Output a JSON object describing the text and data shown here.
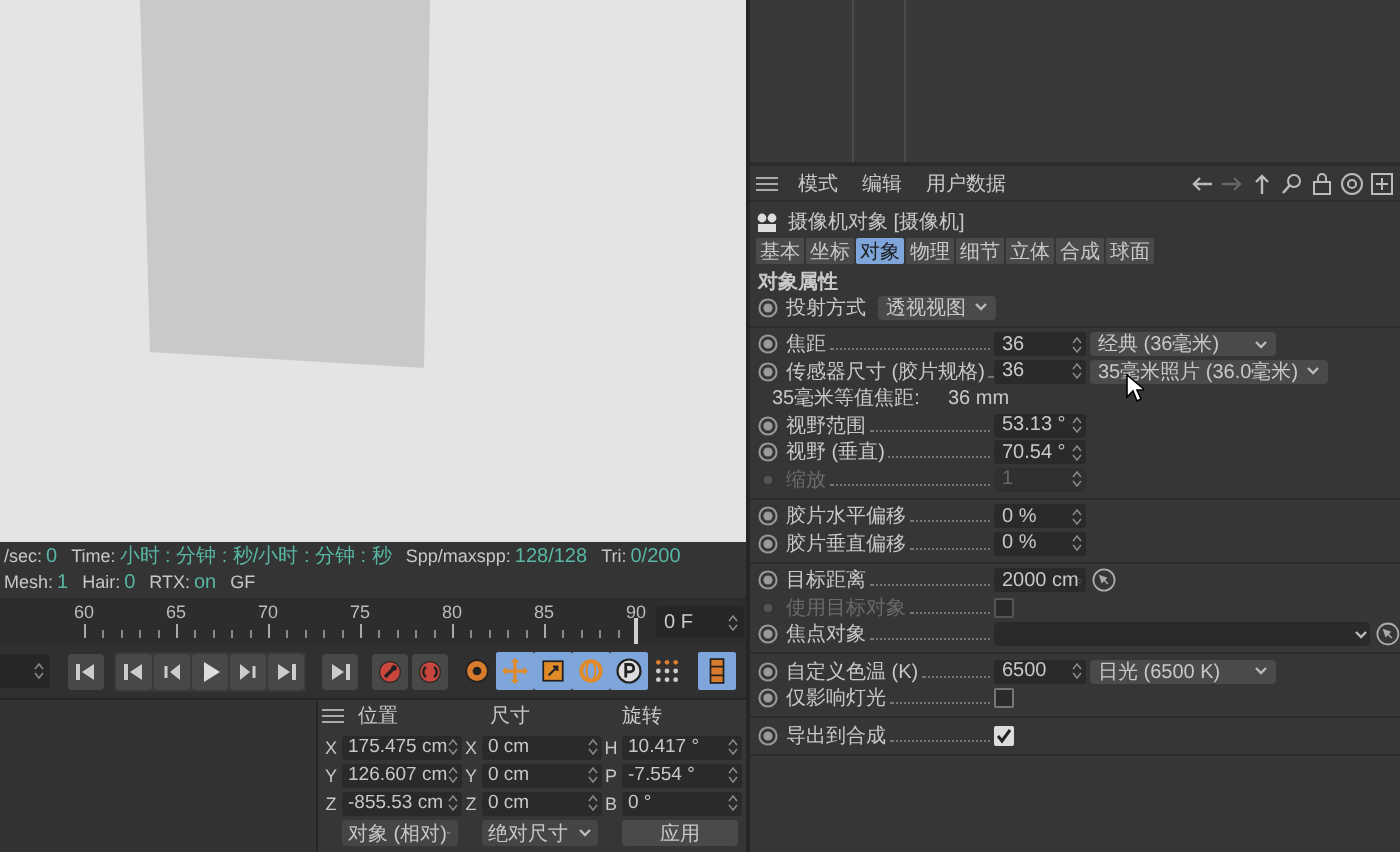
{
  "status_bar": [
    {
      "label": "/sec:",
      "value": "0"
    },
    {
      "label": "Time:",
      "value": "小时 : 分钟 : 秒/小时 : 分钟 : 秒"
    },
    {
      "label": "Spp/maxspp:",
      "value": "128/128"
    },
    {
      "label": "Tri:",
      "value": "0/200"
    },
    {
      "label": "Mesh:",
      "value": "1"
    },
    {
      "label": "Hair:",
      "value": "0"
    },
    {
      "label": "RTX:",
      "value": "on"
    },
    {
      "label": "GF"
    }
  ],
  "timeline": {
    "ticks": [
      {
        "label": "60",
        "selected": false
      },
      {
        "label": "65",
        "selected": false
      },
      {
        "label": "70",
        "selected": false
      },
      {
        "label": "75",
        "selected": false
      },
      {
        "label": "80",
        "selected": false
      },
      {
        "label": "85",
        "selected": false
      },
      {
        "label": "90",
        "selected": true
      }
    ],
    "frame_field": "0 F"
  },
  "mode_tools": [
    {
      "selected": false
    },
    {
      "selected": true
    },
    {
      "selected": true
    },
    {
      "selected": true
    },
    {
      "selected": true
    },
    {
      "selected": false
    },
    {
      "selected": true
    }
  ],
  "coordinates": {
    "headers": [
      "位置",
      "尺寸",
      "旋转"
    ],
    "rows": [
      {
        "position_axis": "X",
        "position": "175.475 cm",
        "size_axis": "X",
        "size": "0 cm",
        "rotation_axis": "H",
        "rotation": "10.417 °"
      },
      {
        "position_axis": "Y",
        "position": "126.607 cm",
        "size_axis": "Y",
        "size": "0 cm",
        "rotation_axis": "P",
        "rotation": "-7.554 °"
      },
      {
        "position_axis": "Z",
        "position": "-855.53 cm",
        "size_axis": "Z",
        "size": "0 cm",
        "rotation_axis": "B",
        "rotation": "0 °"
      }
    ],
    "position_mode": "对象 (相对)",
    "size_mode": "绝对尺寸",
    "apply_button": "应用"
  },
  "attributes": {
    "menu": [
      "模式",
      "编辑",
      "用户数据"
    ],
    "object_title": "摄像机对象 [摄像机]",
    "tabs": [
      {
        "label": "基本",
        "selected": false
      },
      {
        "label": "坐标",
        "selected": false
      },
      {
        "label": "对象",
        "selected": true
      },
      {
        "label": "物理",
        "selected": false
      },
      {
        "label": "细节",
        "selected": false
      },
      {
        "label": "立体",
        "selected": false
      },
      {
        "label": "合成",
        "selected": false
      },
      {
        "label": "球面",
        "selected": false
      }
    ],
    "section_title": "对象属性",
    "projection": {
      "label": "投射方式",
      "value": "透视视图"
    },
    "groups": [
      [
        {
          "kind": "spin_option",
          "label": "焦距",
          "value": "36",
          "option": "经典 (36毫米)",
          "disabled": false
        },
        {
          "kind": "spin_option",
          "label": "传感器尺寸 (胶片规格)",
          "value": "36",
          "option": "35毫米照片 (36.0毫米)",
          "disabled": false
        },
        {
          "kind": "info",
          "label": "35毫米等值焦距:",
          "value": "36 mm",
          "disabled": false
        },
        {
          "kind": "spin",
          "label": "视野范围",
          "value": "53.13 °",
          "disabled": false
        },
        {
          "kind": "spin",
          "label": "视野 (垂直)",
          "value": "70.54 °",
          "disabled": false
        },
        {
          "kind": "spin",
          "label": "缩放",
          "value": "1",
          "disabled": true
        }
      ],
      [
        {
          "kind": "spin",
          "label": "胶片水平偏移",
          "value": "0 %",
          "disabled": false
        },
        {
          "kind": "spin",
          "label": "胶片垂直偏移",
          "value": "0 %",
          "disabled": false
        }
      ],
      [
        {
          "kind": "spin_pick",
          "label": "目标距离",
          "value": "2000 cm",
          "disabled": false
        },
        {
          "kind": "check",
          "label": "使用目标对象",
          "checked": false,
          "disabled": true
        },
        {
          "kind": "link",
          "label": "焦点对象",
          "disabled": false
        }
      ],
      [
        {
          "kind": "spin_option",
          "label": "自定义色温 (K)",
          "value": "6500",
          "option": "日光 (6500 K)",
          "disabled": false
        },
        {
          "kind": "check",
          "label": "仅影响灯光",
          "checked": false,
          "disabled": false
        }
      ],
      [
        {
          "kind": "check",
          "label": "导出到合成",
          "checked": true,
          "disabled": false
        }
      ]
    ]
  }
}
